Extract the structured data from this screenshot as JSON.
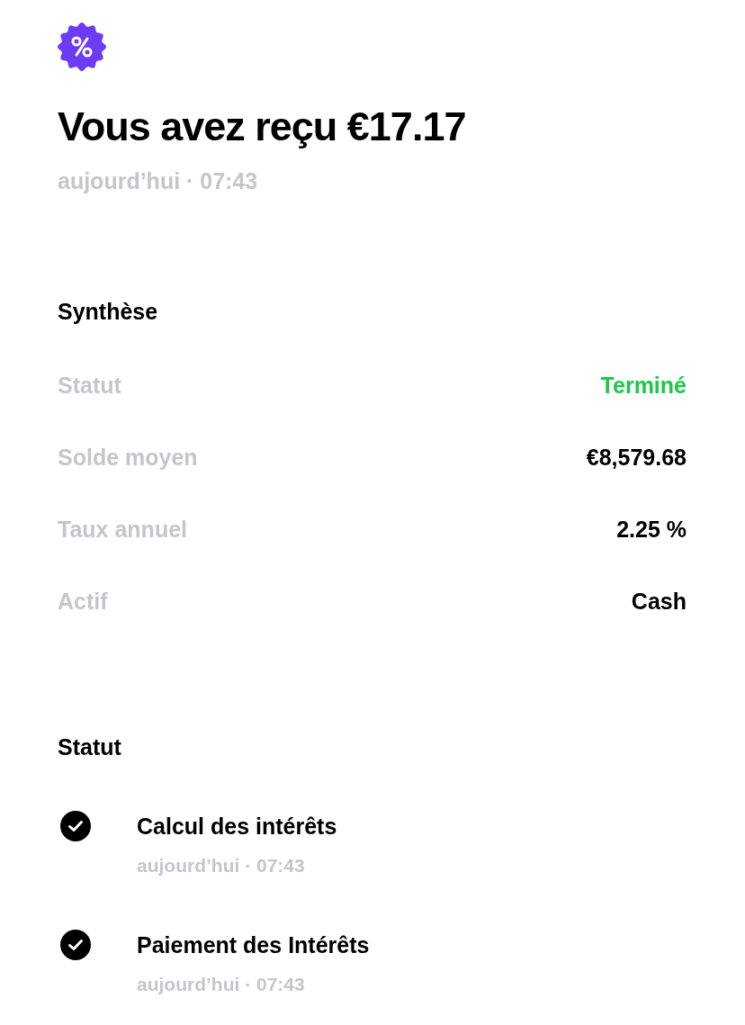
{
  "header": {
    "title": "Vous avez reçu €17.17",
    "subtitle": "aujourd’hui · 07:43"
  },
  "summary": {
    "heading": "Synthèse",
    "rows": [
      {
        "label": "Statut",
        "value": "Terminé",
        "kind": "status"
      },
      {
        "label": "Solde moyen",
        "value": "€8,579.68",
        "kind": "plain"
      },
      {
        "label": "Taux annuel",
        "value": "2.25 %",
        "kind": "plain"
      },
      {
        "label": "Actif",
        "value": "Cash",
        "kind": "plain"
      }
    ]
  },
  "status": {
    "heading": "Statut",
    "steps": [
      {
        "title": "Calcul des intérêts",
        "time": "aujourd’hui · 07:43",
        "completed": true
      },
      {
        "title": "Paiement des Intérêts",
        "time": "aujourd’hui · 07:43",
        "completed": true
      }
    ]
  }
}
